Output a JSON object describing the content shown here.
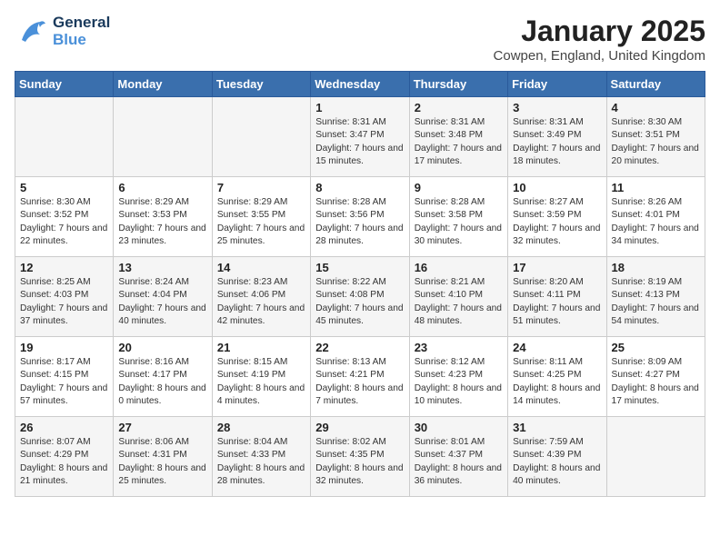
{
  "header": {
    "logo_general": "General",
    "logo_blue": "Blue",
    "month_title": "January 2025",
    "location": "Cowpen, England, United Kingdom"
  },
  "days_of_week": [
    "Sunday",
    "Monday",
    "Tuesday",
    "Wednesday",
    "Thursday",
    "Friday",
    "Saturday"
  ],
  "weeks": [
    [
      {
        "day": "",
        "sunrise": "",
        "sunset": "",
        "daylight": ""
      },
      {
        "day": "",
        "sunrise": "",
        "sunset": "",
        "daylight": ""
      },
      {
        "day": "",
        "sunrise": "",
        "sunset": "",
        "daylight": ""
      },
      {
        "day": "1",
        "sunrise": "Sunrise: 8:31 AM",
        "sunset": "Sunset: 3:47 PM",
        "daylight": "Daylight: 7 hours and 15 minutes."
      },
      {
        "day": "2",
        "sunrise": "Sunrise: 8:31 AM",
        "sunset": "Sunset: 3:48 PM",
        "daylight": "Daylight: 7 hours and 17 minutes."
      },
      {
        "day": "3",
        "sunrise": "Sunrise: 8:31 AM",
        "sunset": "Sunset: 3:49 PM",
        "daylight": "Daylight: 7 hours and 18 minutes."
      },
      {
        "day": "4",
        "sunrise": "Sunrise: 8:30 AM",
        "sunset": "Sunset: 3:51 PM",
        "daylight": "Daylight: 7 hours and 20 minutes."
      }
    ],
    [
      {
        "day": "5",
        "sunrise": "Sunrise: 8:30 AM",
        "sunset": "Sunset: 3:52 PM",
        "daylight": "Daylight: 7 hours and 22 minutes."
      },
      {
        "day": "6",
        "sunrise": "Sunrise: 8:29 AM",
        "sunset": "Sunset: 3:53 PM",
        "daylight": "Daylight: 7 hours and 23 minutes."
      },
      {
        "day": "7",
        "sunrise": "Sunrise: 8:29 AM",
        "sunset": "Sunset: 3:55 PM",
        "daylight": "Daylight: 7 hours and 25 minutes."
      },
      {
        "day": "8",
        "sunrise": "Sunrise: 8:28 AM",
        "sunset": "Sunset: 3:56 PM",
        "daylight": "Daylight: 7 hours and 28 minutes."
      },
      {
        "day": "9",
        "sunrise": "Sunrise: 8:28 AM",
        "sunset": "Sunset: 3:58 PM",
        "daylight": "Daylight: 7 hours and 30 minutes."
      },
      {
        "day": "10",
        "sunrise": "Sunrise: 8:27 AM",
        "sunset": "Sunset: 3:59 PM",
        "daylight": "Daylight: 7 hours and 32 minutes."
      },
      {
        "day": "11",
        "sunrise": "Sunrise: 8:26 AM",
        "sunset": "Sunset: 4:01 PM",
        "daylight": "Daylight: 7 hours and 34 minutes."
      }
    ],
    [
      {
        "day": "12",
        "sunrise": "Sunrise: 8:25 AM",
        "sunset": "Sunset: 4:03 PM",
        "daylight": "Daylight: 7 hours and 37 minutes."
      },
      {
        "day": "13",
        "sunrise": "Sunrise: 8:24 AM",
        "sunset": "Sunset: 4:04 PM",
        "daylight": "Daylight: 7 hours and 40 minutes."
      },
      {
        "day": "14",
        "sunrise": "Sunrise: 8:23 AM",
        "sunset": "Sunset: 4:06 PM",
        "daylight": "Daylight: 7 hours and 42 minutes."
      },
      {
        "day": "15",
        "sunrise": "Sunrise: 8:22 AM",
        "sunset": "Sunset: 4:08 PM",
        "daylight": "Daylight: 7 hours and 45 minutes."
      },
      {
        "day": "16",
        "sunrise": "Sunrise: 8:21 AM",
        "sunset": "Sunset: 4:10 PM",
        "daylight": "Daylight: 7 hours and 48 minutes."
      },
      {
        "day": "17",
        "sunrise": "Sunrise: 8:20 AM",
        "sunset": "Sunset: 4:11 PM",
        "daylight": "Daylight: 7 hours and 51 minutes."
      },
      {
        "day": "18",
        "sunrise": "Sunrise: 8:19 AM",
        "sunset": "Sunset: 4:13 PM",
        "daylight": "Daylight: 7 hours and 54 minutes."
      }
    ],
    [
      {
        "day": "19",
        "sunrise": "Sunrise: 8:17 AM",
        "sunset": "Sunset: 4:15 PM",
        "daylight": "Daylight: 7 hours and 57 minutes."
      },
      {
        "day": "20",
        "sunrise": "Sunrise: 8:16 AM",
        "sunset": "Sunset: 4:17 PM",
        "daylight": "Daylight: 8 hours and 0 minutes."
      },
      {
        "day": "21",
        "sunrise": "Sunrise: 8:15 AM",
        "sunset": "Sunset: 4:19 PM",
        "daylight": "Daylight: 8 hours and 4 minutes."
      },
      {
        "day": "22",
        "sunrise": "Sunrise: 8:13 AM",
        "sunset": "Sunset: 4:21 PM",
        "daylight": "Daylight: 8 hours and 7 minutes."
      },
      {
        "day": "23",
        "sunrise": "Sunrise: 8:12 AM",
        "sunset": "Sunset: 4:23 PM",
        "daylight": "Daylight: 8 hours and 10 minutes."
      },
      {
        "day": "24",
        "sunrise": "Sunrise: 8:11 AM",
        "sunset": "Sunset: 4:25 PM",
        "daylight": "Daylight: 8 hours and 14 minutes."
      },
      {
        "day": "25",
        "sunrise": "Sunrise: 8:09 AM",
        "sunset": "Sunset: 4:27 PM",
        "daylight": "Daylight: 8 hours and 17 minutes."
      }
    ],
    [
      {
        "day": "26",
        "sunrise": "Sunrise: 8:07 AM",
        "sunset": "Sunset: 4:29 PM",
        "daylight": "Daylight: 8 hours and 21 minutes."
      },
      {
        "day": "27",
        "sunrise": "Sunrise: 8:06 AM",
        "sunset": "Sunset: 4:31 PM",
        "daylight": "Daylight: 8 hours and 25 minutes."
      },
      {
        "day": "28",
        "sunrise": "Sunrise: 8:04 AM",
        "sunset": "Sunset: 4:33 PM",
        "daylight": "Daylight: 8 hours and 28 minutes."
      },
      {
        "day": "29",
        "sunrise": "Sunrise: 8:02 AM",
        "sunset": "Sunset: 4:35 PM",
        "daylight": "Daylight: 8 hours and 32 minutes."
      },
      {
        "day": "30",
        "sunrise": "Sunrise: 8:01 AM",
        "sunset": "Sunset: 4:37 PM",
        "daylight": "Daylight: 8 hours and 36 minutes."
      },
      {
        "day": "31",
        "sunrise": "Sunrise: 7:59 AM",
        "sunset": "Sunset: 4:39 PM",
        "daylight": "Daylight: 8 hours and 40 minutes."
      },
      {
        "day": "",
        "sunrise": "",
        "sunset": "",
        "daylight": ""
      }
    ]
  ]
}
